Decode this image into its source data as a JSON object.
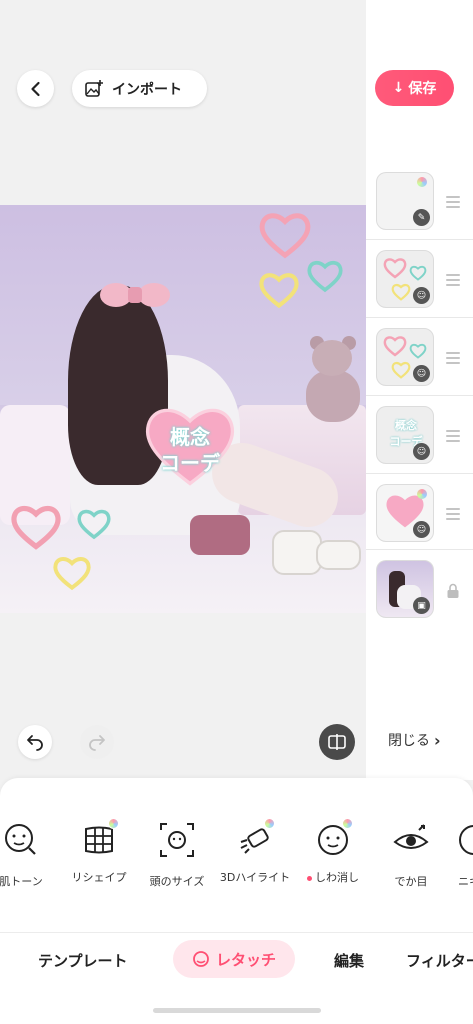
{
  "header": {
    "import_label": "インポート",
    "save_label": "保存"
  },
  "canvas": {
    "sticker_text_line1": "概念",
    "sticker_text_line2": "コーデ"
  },
  "layers": {
    "items": [
      {
        "name": "layer-sketch"
      },
      {
        "name": "layer-hearts-a"
      },
      {
        "name": "layer-hearts-b"
      },
      {
        "name": "layer-text",
        "text_line1": "概念",
        "text_line2": "コーデ"
      },
      {
        "name": "layer-heart-pink"
      },
      {
        "name": "layer-photo"
      }
    ]
  },
  "controls": {
    "close_label": "閉じる"
  },
  "tools": [
    {
      "label": "肌トーン",
      "icon": "face-tone-icon"
    },
    {
      "label": "リシェイプ",
      "icon": "reshape-grid-icon"
    },
    {
      "label": "頭のサイズ",
      "icon": "head-size-icon"
    },
    {
      "label": "3Dハイライト",
      "icon": "highlight-icon"
    },
    {
      "label": "しわ消し",
      "icon": "wrinkle-face-icon"
    },
    {
      "label": "でか目",
      "icon": "big-eye-icon"
    },
    {
      "label": "ニキ",
      "icon": "face-icon"
    }
  ],
  "tabs": {
    "template": "テンプレート",
    "retouch": "レタッチ",
    "edit": "編集",
    "filter": "フィルター"
  },
  "colors": {
    "accent": "#ff4f73",
    "accent_bg": "#ffe6ec"
  }
}
